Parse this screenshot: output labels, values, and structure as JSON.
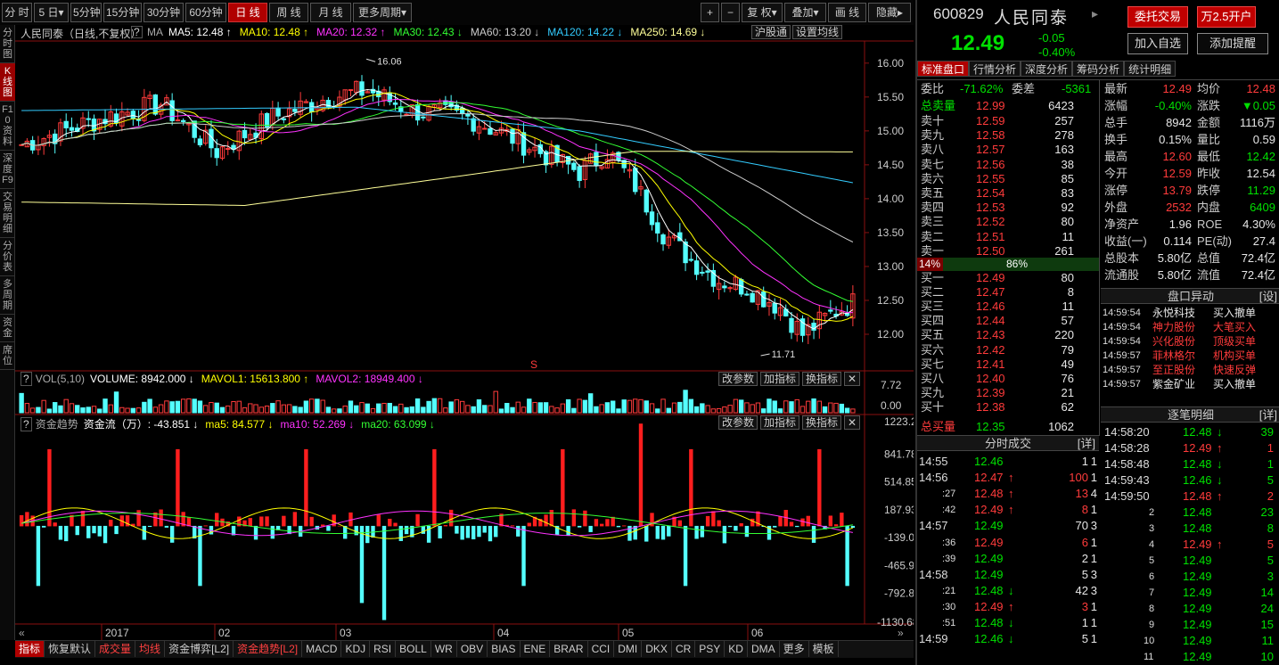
{
  "toolbar": {
    "periods": [
      "分 时",
      "5 日▾",
      "5分钟",
      "15分钟",
      "30分钟",
      "60分钟",
      "日 线",
      "周 线",
      "月 线",
      "更多周期▾"
    ],
    "right_buttons": [
      "+",
      "−",
      "复 权▾",
      "叠加▾",
      "画 线",
      "隐藏▸"
    ]
  },
  "leftnav": [
    "分时图",
    "K线图",
    "F10资料",
    "深度F9",
    "交易明细",
    "分价表",
    "多周期",
    "资金",
    "席位"
  ],
  "chart": {
    "title": "人民同泰（日线,不复权）",
    "ma_label": "MA",
    "ma": [
      {
        "t": "MA5: 12.48 ↑",
        "c": "#ffffff"
      },
      {
        "t": "MA10: 12.48 ↑",
        "c": "#ffff00"
      },
      {
        "t": "MA20: 12.32 ↑",
        "c": "#ff33ff"
      },
      {
        "t": "MA30: 12.43 ↓",
        "c": "#33ff33"
      },
      {
        "t": "MA60: 13.20 ↓",
        "c": "#cccccc"
      },
      {
        "t": "MA120: 14.22 ↓",
        "c": "#33ccff"
      },
      {
        "t": "MA250: 14.69 ↓",
        "c": "#ffff99"
      }
    ],
    "hgt_btn": "沪股通",
    "ma_set_btn": "设置均线",
    "price_ticks": [
      "16.00",
      "15.50",
      "15.00",
      "14.50",
      "14.00",
      "13.50",
      "13.00",
      "12.50",
      "12.00"
    ],
    "high_label": "16.06",
    "low_label": "11.71",
    "vol_label": "VOL(5,10)",
    "volume": "VOLUME: 8942.000 ↓",
    "mavol1": "MAVOL1: 15613.800 ↑",
    "mavol2": "MAVOL2: 18949.400 ↓",
    "vol_ticks": [
      "7.72",
      "0.00"
    ],
    "flow_label": "资金趋势",
    "flow": "资金流（万）: -43.851 ↓",
    "flow_ma5": "ma5: 84.577 ↓",
    "flow_ma10": "ma10: 52.269 ↓",
    "flow_ma20": "ma20: 63.099 ↓",
    "flow_ticks": [
      "1223.20",
      "841.78",
      "514.85",
      "187.93",
      "-139.00",
      "-465.93",
      "-792.86",
      "-1130.68"
    ],
    "panel_btns": [
      "改参数",
      "加指标",
      "换指标"
    ],
    "dates": [
      "2017",
      "02",
      "03",
      "04",
      "05",
      "06"
    ],
    "s_marker": "S"
  },
  "chart_data": {
    "type": "candlestick",
    "symbol": "600829",
    "name": "人民同泰",
    "period": "日线",
    "ylim": [
      11.5,
      16.3
    ],
    "high": 16.06,
    "low": 11.71,
    "ma_last": {
      "MA5": 12.48,
      "MA10": 12.48,
      "MA20": 12.32,
      "MA30": 12.43,
      "MA60": 13.2,
      "MA120": 14.22,
      "MA250": 14.69
    },
    "volume_ylim": [
      0,
      7.72
    ],
    "flow_ylim": [
      -1130.68,
      1223.2
    ],
    "flow_last": {
      "value": -43.851,
      "ma5": 84.577,
      "ma10": 52.269,
      "ma20": 63.099
    },
    "x_ticks": [
      "2017",
      "02",
      "03",
      "04",
      "05",
      "06"
    ]
  },
  "bottom_tabs": [
    "指标",
    "恢复默认",
    "成交量",
    "均线",
    "资金博弈[L2]",
    "资金趋势[L2]",
    "MACD",
    "KDJ",
    "RSI",
    "BOLL",
    "WR",
    "OBV",
    "BIAS",
    "ENE",
    "BRAR",
    "CCI",
    "DMI",
    "DKX",
    "CR",
    "PSY",
    "KD",
    "DMA",
    "更多",
    "模板"
  ],
  "stock": {
    "code": "600829",
    "name": "人民同泰",
    "price": "12.49",
    "chg": "-0.05",
    "pct": "-0.40%"
  },
  "actions": {
    "trade": "委托交易",
    "open": "万2.5开户",
    "add": "加入自选",
    "alert": "添加提醒"
  },
  "tabs": [
    "标准盘口",
    "行情分析",
    "深度分析",
    "筹码分析",
    "统计明细"
  ],
  "book": {
    "wb_label": "委比",
    "wb": "-71.62%",
    "wc_label": "委差",
    "wc": "-5361",
    "total_sell_label": "总卖量",
    "total_sell_price": "12.99",
    "total_sell_vol": "6423",
    "asks": [
      [
        "卖十",
        "12.59",
        "257"
      ],
      [
        "卖九",
        "12.58",
        "278"
      ],
      [
        "卖八",
        "12.57",
        "163"
      ],
      [
        "卖七",
        "12.56",
        "38"
      ],
      [
        "卖六",
        "12.55",
        "85"
      ],
      [
        "卖五",
        "12.54",
        "83"
      ],
      [
        "卖四",
        "12.53",
        "92"
      ],
      [
        "卖三",
        "12.52",
        "80"
      ],
      [
        "卖二",
        "12.51",
        "11"
      ],
      [
        "卖一",
        "12.50",
        "261"
      ]
    ],
    "bar_left": "14%",
    "bar_right": "86%",
    "bar_ratio": 0.14,
    "bids": [
      [
        "买一",
        "12.49",
        "80"
      ],
      [
        "买二",
        "12.47",
        "8"
      ],
      [
        "买三",
        "12.46",
        "11"
      ],
      [
        "买四",
        "12.44",
        "57"
      ],
      [
        "买五",
        "12.43",
        "220"
      ],
      [
        "买六",
        "12.42",
        "79"
      ],
      [
        "买七",
        "12.41",
        "49"
      ],
      [
        "买八",
        "12.40",
        "76"
      ],
      [
        "买九",
        "12.39",
        "21"
      ],
      [
        "买十",
        "12.38",
        "62"
      ]
    ],
    "total_buy_label": "总买量",
    "total_buy_price": "12.35",
    "total_buy_vol": "1062"
  },
  "stats": [
    [
      "最新",
      "12.49",
      "red",
      "均价",
      "12.48",
      "red"
    ],
    [
      "涨幅",
      "-0.40%",
      "green",
      "涨跌",
      "▼0.05",
      "green"
    ],
    [
      "总手",
      "8942",
      "white",
      "金额",
      "1116万",
      "white"
    ],
    [
      "换手",
      "0.15%",
      "white",
      "量比",
      "0.59",
      "white"
    ],
    [
      "最高",
      "12.60",
      "red",
      "最低",
      "12.42",
      "green"
    ],
    [
      "今开",
      "12.59",
      "red",
      "昨收",
      "12.54",
      "white"
    ],
    [
      "涨停",
      "13.79",
      "red",
      "跌停",
      "11.29",
      "green"
    ],
    [
      "外盘",
      "2532",
      "red",
      "内盘",
      "6409",
      "green"
    ],
    [
      "净资产",
      "1.96",
      "white",
      "ROE",
      "4.30%",
      "white"
    ],
    [
      "收益(一)",
      "0.114",
      "white",
      "PE(动)",
      "27.4",
      "white"
    ],
    [
      "总股本",
      "5.80亿",
      "white",
      "总值",
      "72.4亿",
      "white"
    ],
    [
      "流通股",
      "5.80亿",
      "white",
      "流值",
      "72.4亿",
      "white"
    ]
  ],
  "ticks_title": "分时成交",
  "detail_btn": "[详]",
  "ticks": [
    [
      "14:55",
      "12.46",
      "",
      "1",
      "1",
      "green"
    ],
    [
      "14:56",
      "12.47",
      "↑",
      "100",
      "1",
      "red"
    ],
    [
      ":27",
      "12.48",
      "↑",
      "13",
      "4",
      "red"
    ],
    [
      ":42",
      "12.49",
      "↑",
      "8",
      "1",
      "red"
    ],
    [
      "14:57",
      "12.49",
      "",
      "70",
      "3",
      "green"
    ],
    [
      ":36",
      "12.49",
      "",
      "6",
      "1",
      "red"
    ],
    [
      ":39",
      "12.49",
      "",
      "2",
      "1",
      "green"
    ],
    [
      "14:58",
      "12.49",
      "",
      "5",
      "3",
      "green"
    ],
    [
      ":21",
      "12.48",
      "↓",
      "42",
      "3",
      "green"
    ],
    [
      ":30",
      "12.49",
      "↑",
      "3",
      "1",
      "red"
    ],
    [
      ":51",
      "12.48",
      "↓",
      "1",
      "1",
      "green"
    ],
    [
      "14:59",
      "12.46",
      "↓",
      "5",
      "1",
      "green"
    ]
  ],
  "alerts_title": "盘口异动",
  "alerts_set": "[设]",
  "alerts": [
    [
      "14:59:54",
      "永悦科技",
      "买入撤单",
      "white"
    ],
    [
      "14:59:54",
      "神力股份",
      "大笔买入",
      "red"
    ],
    [
      "14:59:54",
      "兴化股份",
      "顶级买单",
      "red"
    ],
    [
      "14:59:57",
      "菲林格尔",
      "机构买单",
      "red"
    ],
    [
      "14:59:57",
      "至正股份",
      "快速反弹",
      "red"
    ],
    [
      "14:59:57",
      "紫金矿业",
      "买入撤单",
      "white"
    ]
  ],
  "trades_title": "逐笔明细",
  "trades_detail": "[详]",
  "trades": [
    [
      "14:58:20",
      "12.48",
      "↓",
      "39",
      "green"
    ],
    [
      "14:58:28",
      "12.49",
      "↑",
      "1",
      "red"
    ],
    [
      "14:58:48",
      "12.48",
      "↓",
      "1",
      "green"
    ],
    [
      "14:59:43",
      "12.46",
      "↓",
      "5",
      "green"
    ],
    [
      "14:59:50",
      "12.48",
      "↑",
      "2",
      "red"
    ],
    [
      "2",
      "12.48",
      "",
      "23",
      "green"
    ],
    [
      "3",
      "12.48",
      "",
      "8",
      "green"
    ],
    [
      "4",
      "12.49",
      "↑",
      "5",
      "red"
    ],
    [
      "5",
      "12.49",
      "",
      "5",
      "green"
    ],
    [
      "6",
      "12.49",
      "",
      "3",
      "green"
    ],
    [
      "7",
      "12.49",
      "",
      "14",
      "green"
    ],
    [
      "8",
      "12.49",
      "",
      "24",
      "green"
    ],
    [
      "9",
      "12.49",
      "",
      "15",
      "green"
    ],
    [
      "10",
      "12.49",
      "",
      "11",
      "green"
    ],
    [
      "11",
      "12.49",
      "",
      "10",
      "green"
    ]
  ]
}
